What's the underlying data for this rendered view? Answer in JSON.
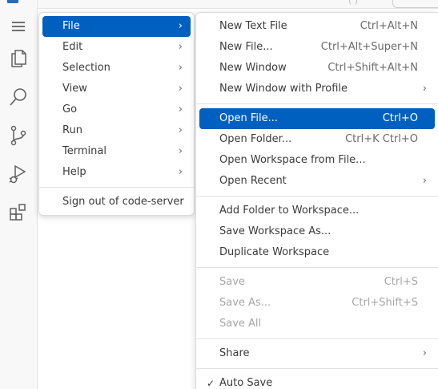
{
  "main_menu": {
    "items": [
      {
        "label": "File"
      },
      {
        "label": "Edit"
      },
      {
        "label": "Selection"
      },
      {
        "label": "View"
      },
      {
        "label": "Go"
      },
      {
        "label": "Run"
      },
      {
        "label": "Terminal"
      },
      {
        "label": "Help"
      }
    ],
    "sign_out": "Sign out of code-server",
    "chevron": "›"
  },
  "file_menu": {
    "group1": [
      {
        "label": "New Text File",
        "shortcut": "Ctrl+Alt+N"
      },
      {
        "label": "New File...",
        "shortcut": "Ctrl+Alt+Super+N"
      },
      {
        "label": "New Window",
        "shortcut": "Ctrl+Shift+Alt+N"
      },
      {
        "label": "New Window with Profile"
      }
    ],
    "group2": [
      {
        "label": "Open File...",
        "shortcut": "Ctrl+O"
      },
      {
        "label": "Open Folder...",
        "shortcut": "Ctrl+K Ctrl+O"
      },
      {
        "label": "Open Workspace from File..."
      },
      {
        "label": "Open Recent"
      }
    ],
    "group3": [
      {
        "label": "Add Folder to Workspace..."
      },
      {
        "label": "Save Workspace As..."
      },
      {
        "label": "Duplicate Workspace"
      }
    ],
    "group4": [
      {
        "label": "Save",
        "shortcut": "Ctrl+S"
      },
      {
        "label": "Save As...",
        "shortcut": "Ctrl+Shift+S"
      },
      {
        "label": "Save All"
      }
    ],
    "group5": [
      {
        "label": "Share"
      }
    ],
    "group6": [
      {
        "label": "Auto Save",
        "check": "✓"
      }
    ]
  },
  "activity_bar": {
    "icons": [
      "menu-icon",
      "explorer-icon",
      "search-icon",
      "source-control-icon",
      "run-debug-icon",
      "extensions-icon"
    ]
  }
}
